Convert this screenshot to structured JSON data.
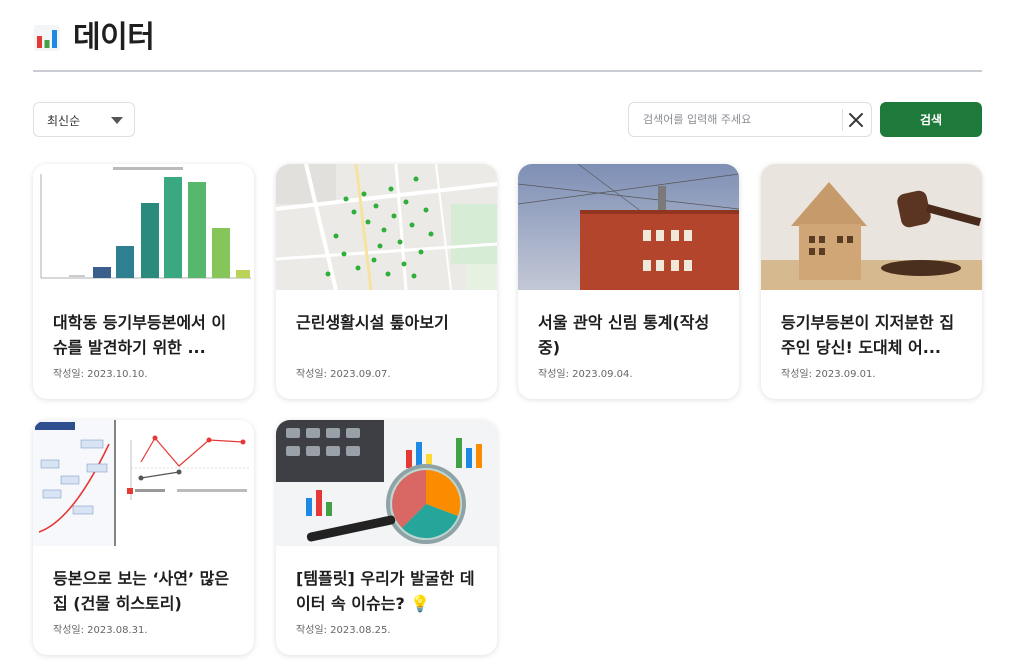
{
  "page": {
    "title": "데이터"
  },
  "toolbar": {
    "sort_label": "최신순",
    "search_placeholder": "검색어를 입력해 주세요",
    "search_button": "검색"
  },
  "colors": {
    "accent": "#1e7a3a"
  },
  "icons": {
    "title": "bar-chart-icon",
    "sort": "caret-down-icon",
    "clear": "close-icon"
  },
  "cards": [
    {
      "title": "대학동 등기부등본에서 이슈를 발견하기 위한 ...",
      "date": "작성일: 2023.10.10.",
      "thumb": "bar-chart-thumbnail"
    },
    {
      "title": "근린생활시설 톺아보기",
      "date": "작성일: 2023.09.07.",
      "thumb": "map-thumbnail"
    },
    {
      "title": "서울 관악 신림 통계(작성 중)",
      "date": "작성일: 2023.09.04.",
      "thumb": "brick-building-photo"
    },
    {
      "title": "등기부등본이 지저분한 집주인 당신! 도대체 어...",
      "date": "작성일: 2023.09.01.",
      "thumb": "house-gavel-photo"
    },
    {
      "title": "등본으로 보는 ‘사연’ 많은 집 (건물 히스토리)",
      "date": "작성일: 2023.08.31.",
      "thumb": "history-chart-thumbnail"
    },
    {
      "title": "[템플릿] 우리가 발굴한 데이터 속 이슈는? 💡",
      "date": "작성일: 2023.08.25.",
      "thumb": "magnifier-calculator-photo"
    }
  ]
}
